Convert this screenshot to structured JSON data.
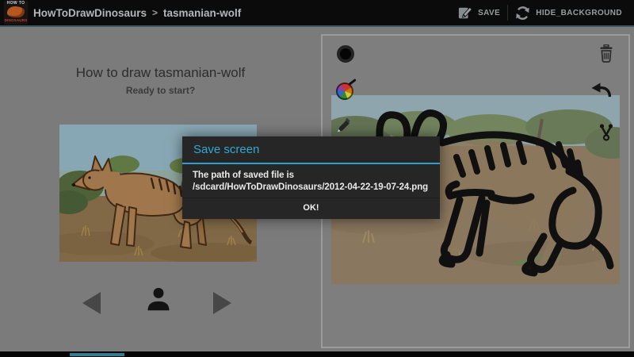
{
  "header": {
    "app_icon": {
      "top_text": "HOW TO",
      "bottom_text": "DINOSAURS"
    },
    "breadcrumb": {
      "app": "HowToDrawDinosaurs",
      "separator": ">",
      "page": "tasmanian-wolf"
    },
    "actions": {
      "save": {
        "label": "SAVE"
      },
      "hide_background": {
        "label": "HIDE_BACKGROUND"
      }
    }
  },
  "left_panel": {
    "title": "How to draw tasmanian-wolf",
    "subtitle": "Ready to start?"
  },
  "canvas_panel": {
    "tools_left": [
      "brush-size",
      "color-picker",
      "pencil"
    ],
    "tools_right": [
      "trash",
      "undo",
      "share"
    ]
  },
  "dialog": {
    "title": "Save screen",
    "message_line1": "The path of saved file is",
    "message_line2": "/sdcard/HowToDrawDinosaurs/2012-04-22-19-07-24.png",
    "ok_label": "OK!"
  },
  "colors": {
    "holo_blue": "#33b5e5",
    "actionbar_underline": "#3e5a68",
    "content_background": "#7b7b7b",
    "dialog_background": "#262626",
    "bottom_strip": "#2f7f92"
  }
}
